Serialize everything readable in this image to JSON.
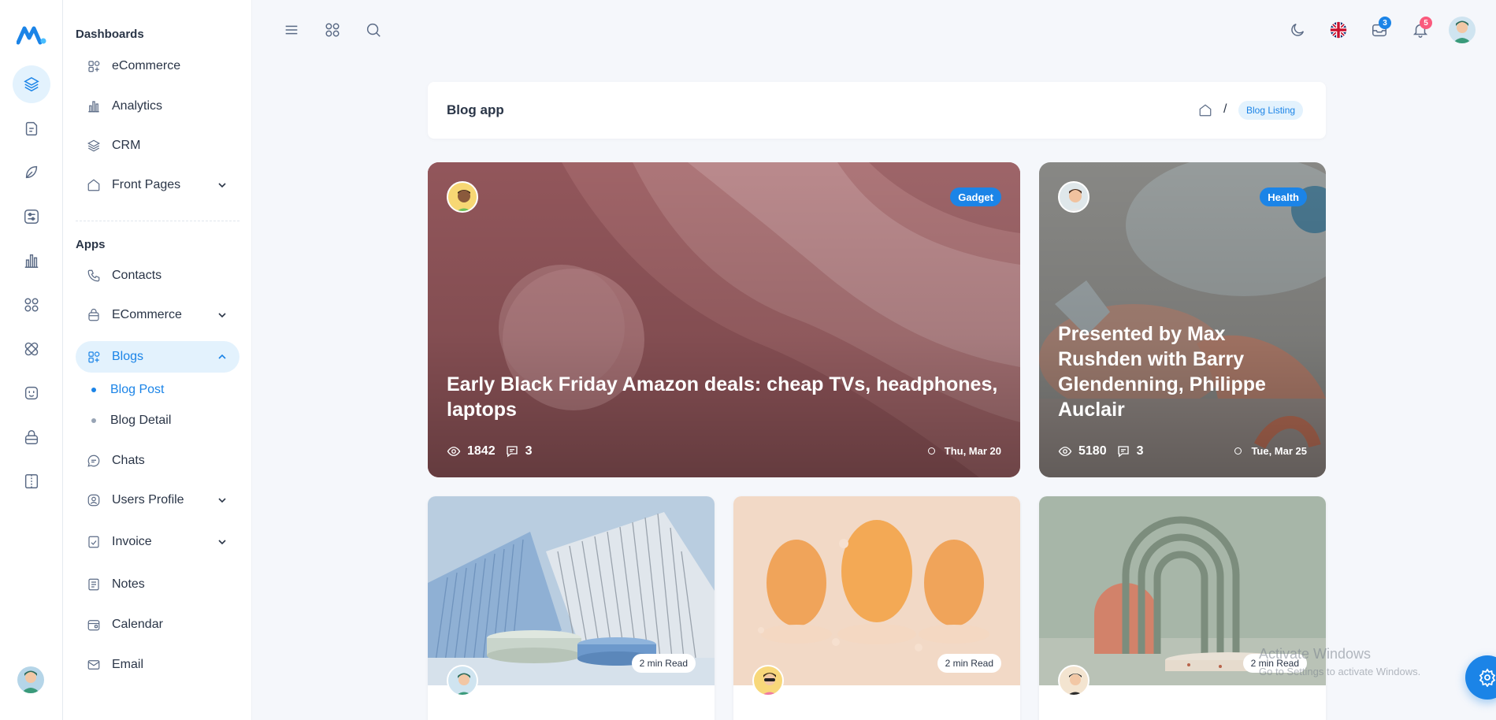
{
  "colors": {
    "accent": "#1b84e7",
    "accent_soft": "#e3f2fd",
    "text": "#2a3547",
    "muted": "#5a6a85"
  },
  "rail": {
    "items": [
      {
        "icon": "layers-icon",
        "active": true
      },
      {
        "icon": "document-icon",
        "active": false
      },
      {
        "icon": "leaf-icon",
        "active": false
      },
      {
        "icon": "sliders-icon",
        "active": false
      },
      {
        "icon": "bar-chart-icon",
        "active": false
      },
      {
        "icon": "apps-icon",
        "active": false
      },
      {
        "icon": "bandage-icon",
        "active": false
      },
      {
        "icon": "face-icon",
        "active": false
      },
      {
        "icon": "lock-icon",
        "active": false
      },
      {
        "icon": "book-icon",
        "active": false
      }
    ]
  },
  "sidebar": {
    "dashboards_title": "Dashboards",
    "apps_title": "Apps",
    "dashboards": [
      {
        "label": "eCommerce",
        "icon": "shop-icon"
      },
      {
        "label": "Analytics",
        "icon": "chart-icon"
      },
      {
        "label": "CRM",
        "icon": "layers-icon"
      },
      {
        "label": "Front Pages",
        "icon": "home-icon",
        "expandable": true
      }
    ],
    "apps": [
      {
        "label": "Contacts",
        "icon": "phone-icon"
      },
      {
        "label": "ECommerce",
        "icon": "basket-icon",
        "expandable": true
      },
      {
        "label": "Blogs",
        "icon": "widget-icon",
        "expandable": true,
        "active": true
      },
      {
        "label": "Chats",
        "icon": "chat-icon"
      },
      {
        "label": "Users Profile",
        "icon": "user-circle-icon",
        "expandable": true
      },
      {
        "label": "Invoice",
        "icon": "invoice-icon",
        "expandable": true
      },
      {
        "label": "Notes",
        "icon": "notes-icon"
      },
      {
        "label": "Calendar",
        "icon": "calendar-icon"
      },
      {
        "label": "Email",
        "icon": "mail-icon"
      }
    ],
    "blog_sub": [
      {
        "label": "Blog Post",
        "active": true
      },
      {
        "label": "Blog Detail",
        "active": false
      }
    ]
  },
  "topbar": {
    "messages_count": "3",
    "notifications_count": "5"
  },
  "breadcrumb": {
    "title": "Blog app",
    "separator": "/",
    "current": "Blog Listing"
  },
  "featured": [
    {
      "category": "Gadget",
      "title": "Early Black Friday Amazon deals: cheap TVs, headphones, laptops",
      "views": "1842",
      "comments": "3",
      "date": "Thu, Mar 20"
    },
    {
      "category": "Health",
      "title": "Presented by Max Rushden with Barry Glendenning, Philippe Auclair",
      "views": "5180",
      "comments": "3",
      "date": "Tue, Mar 25"
    }
  ],
  "cards": [
    {
      "read": "2 min Read"
    },
    {
      "read": "2 min Read"
    },
    {
      "read": "2 min Read"
    }
  ],
  "watermark": {
    "line1": "Activate Windows",
    "line2": "Go to Settings to activate Windows."
  }
}
